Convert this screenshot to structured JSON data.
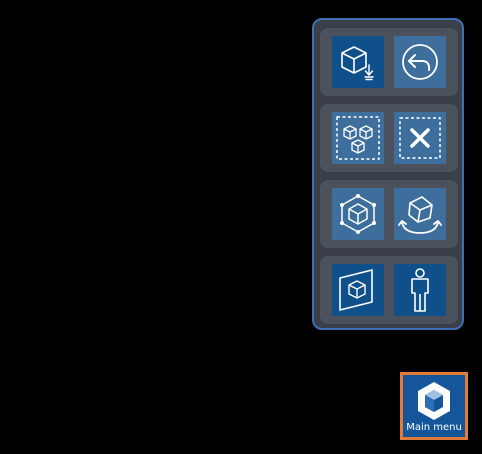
{
  "toolbar": {
    "buttons": [
      {
        "name": "place-object-button",
        "icon": "cube-place-icon"
      },
      {
        "name": "undo-button",
        "icon": "undo-arrow-icon"
      },
      {
        "name": "select-multiple-button",
        "icon": "multi-cube-select-icon"
      },
      {
        "name": "deselect-button",
        "icon": "close-selection-icon"
      },
      {
        "name": "transform-button",
        "icon": "cube-transform-icon"
      },
      {
        "name": "rotate-button",
        "icon": "cube-rotate-icon"
      },
      {
        "name": "view-plane-button",
        "icon": "cube-plane-icon"
      },
      {
        "name": "avatar-button",
        "icon": "person-icon"
      }
    ]
  },
  "main_menu": {
    "label": "Main menu",
    "icon": "app-logo-icon"
  },
  "colors": {
    "background": "#000000",
    "panel_border": "#3d6fb3",
    "panel_fill": "#3a3f4a",
    "row_fill": "#4b515d",
    "button_active": "#0f4f8a",
    "button_inactive": "#3e6f9c",
    "main_menu_border": "#e07b3c",
    "main_menu_fill": "#145699"
  }
}
